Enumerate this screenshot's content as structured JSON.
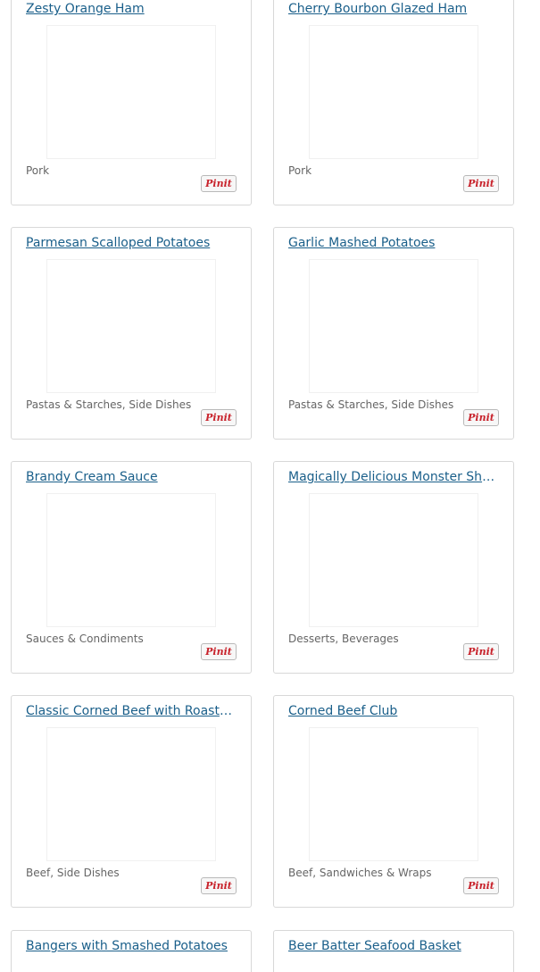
{
  "recipes": [
    {
      "title": "Zesty Orange Ham",
      "category": "Pork",
      "pin_label": "Pinit"
    },
    {
      "title": "Cherry Bourbon Glazed Ham",
      "category": "Pork",
      "pin_label": "Pinit"
    },
    {
      "title": "Parmesan Scalloped Potatoes",
      "category": "Pastas & Starches, Side Dishes",
      "pin_label": "Pinit"
    },
    {
      "title": "Garlic Mashed Potatoes",
      "category": "Pastas & Starches, Side Dishes",
      "pin_label": "Pinit"
    },
    {
      "title": "Brandy Cream Sauce",
      "category": "Sauces & Condiments",
      "pin_label": "Pinit"
    },
    {
      "title": "Magically Delicious Monster Shake",
      "category": "Desserts, Beverages",
      "pin_label": "Pinit"
    },
    {
      "title": "Classic Corned Beef with Roasted Vegetables",
      "category": "Beef, Side Dishes",
      "pin_label": "Pinit"
    },
    {
      "title": "Corned Beef Club",
      "category": "Beef, Sandwiches & Wraps",
      "pin_label": "Pinit"
    },
    {
      "title": "Bangers with Smashed Potatoes",
      "category": "",
      "pin_label": ""
    },
    {
      "title": "Beer Batter Seafood Basket",
      "category": "",
      "pin_label": ""
    }
  ]
}
